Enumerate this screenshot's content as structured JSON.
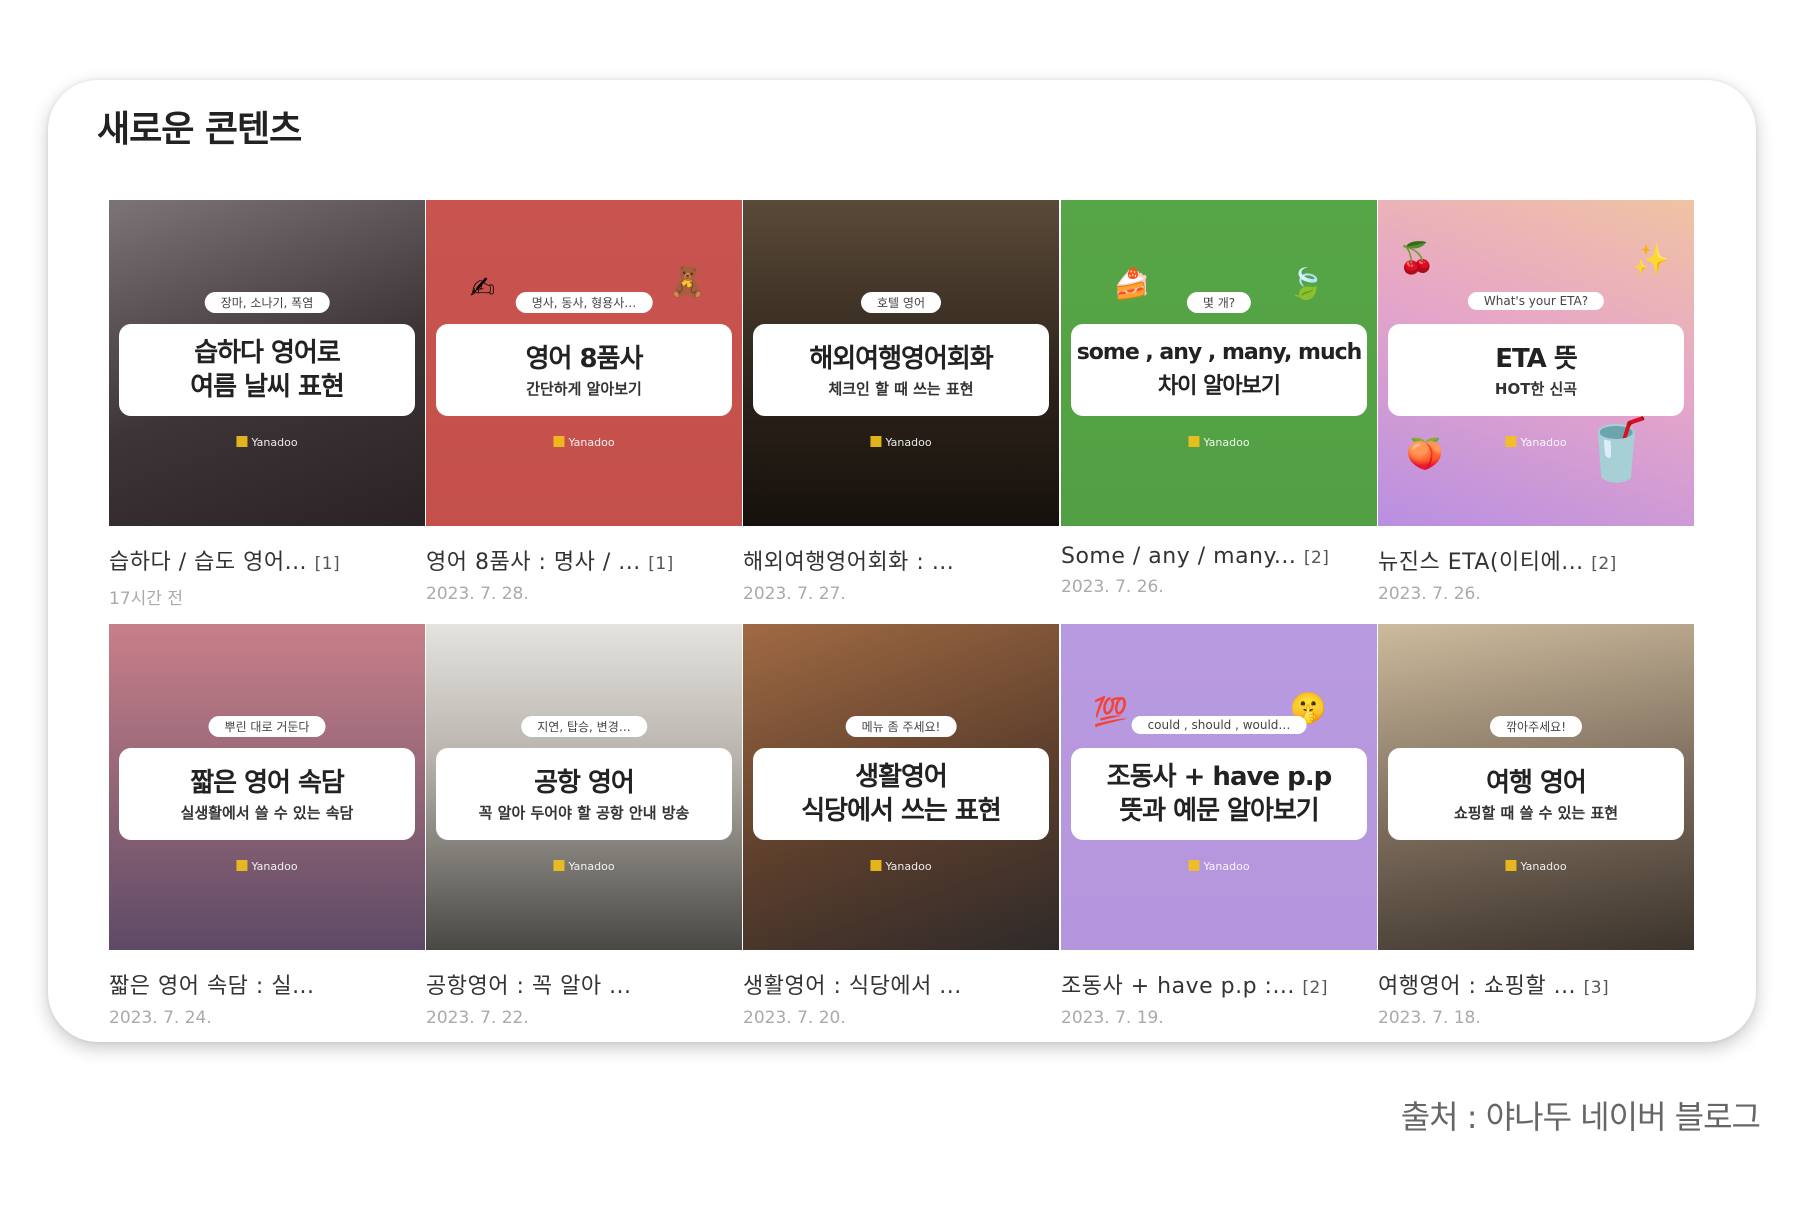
{
  "section": {
    "title": "새로운 콘텐츠"
  },
  "source_note": "출처 : 야나두 네이버 블로그",
  "brand": {
    "logo_text": "Yanadoo",
    "accent": "#f4c21b"
  },
  "items": [
    {
      "pill": "장마, 소나기, 폭염",
      "headline": "습하다 영어로\n여름 날씨 표현",
      "subline": "",
      "bg": "#4a4448",
      "caption": "습하다 / 습도 영어...",
      "count": "[1]",
      "date": "17시간 전"
    },
    {
      "pill": "명사, 동사, 형용사…",
      "headline": "영어 8품사",
      "subline": "간단하게 알아보기",
      "bg": "#c9544f",
      "caption": "영어 8품사 : 명사 / ...",
      "count": "[1]",
      "date": "2023. 7. 28."
    },
    {
      "pill": "호텔 영어",
      "headline": "해외여행영어회화",
      "subline": "체크인 할 때 쓰는 표현",
      "bg": "#3a3128",
      "caption": "해외여행영어회화 : ...",
      "count": "",
      "date": "2023. 7. 27."
    },
    {
      "pill": "몇 개?",
      "headline": "some , any , many, much\n차이 알아보기",
      "subline": "",
      "bg": "#56a546",
      "caption": "Some / any / many...",
      "count": "[2]",
      "date": "2023. 7. 26."
    },
    {
      "pill": "What's your ETA?",
      "headline": "ETA 뜻",
      "subline": "HOT한 신곡",
      "bg": "#e6a6c8",
      "caption": "뉴진스 ETA(이티에...",
      "count": "[2]",
      "date": "2023. 7. 26."
    },
    {
      "pill": "뿌린 대로 거둔다",
      "headline": "짧은 영어 속담",
      "subline": "실생활에서 쓸 수 있는 속담",
      "bg": "#8e6375",
      "caption": "짧은 영어 속담 : 실...",
      "count": "",
      "date": "2023. 7. 24."
    },
    {
      "pill": "지연, 탑승, 변경…",
      "headline": "공항 영어",
      "subline": "꼭 알아 두어야 할 공항 안내 방송",
      "bg": "#9e9b96",
      "caption": "공항영어 : 꼭 알아 ...",
      "count": "",
      "date": "2023. 7. 22."
    },
    {
      "pill": "메뉴 좀 주세요!",
      "headline": "생활영어\n식당에서 쓰는 표현",
      "subline": "",
      "bg": "#6a4a35",
      "caption": "생활영어 : 식당에서 ...",
      "count": "",
      "date": "2023. 7. 20."
    },
    {
      "pill": "could , should , would…",
      "headline": "조동사 + have p.p\n뜻과 예문 알아보기",
      "subline": "",
      "bg": "#b89ae0",
      "caption": "조동사 + have p.p :...",
      "count": "[2]",
      "date": "2023. 7. 19."
    },
    {
      "pill": "깎아주세요!",
      "headline": "여행 영어",
      "subline": "쇼핑할 때 쓸 수 있는 표현",
      "bg": "#7a6a5a",
      "caption": "여행영어 : 쇼핑할 ...",
      "count": "[3]",
      "date": "2023. 7. 18."
    }
  ]
}
